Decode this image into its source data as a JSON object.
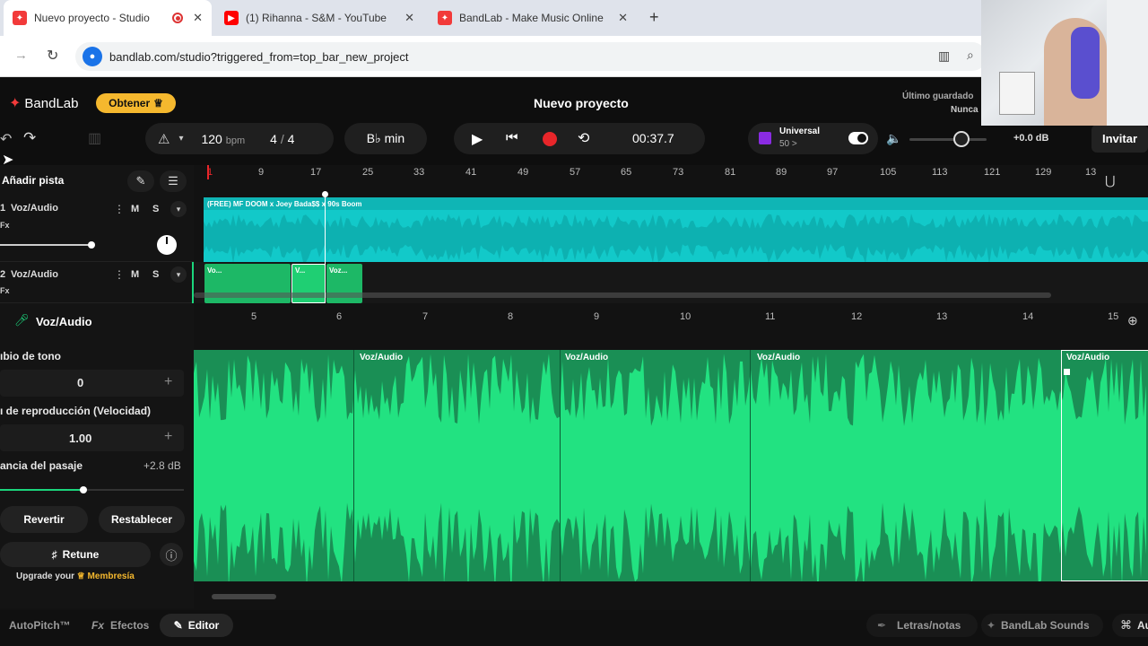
{
  "browser": {
    "tabs": [
      {
        "label": "Nuevo proyecto - Studio"
      },
      {
        "label": "(1) Rihanna - S&M - YouTube"
      },
      {
        "label": "BandLab - Make Music Online"
      }
    ],
    "url": "bandlab.com/studio?triggered_from=top_bar_new_project"
  },
  "app": {
    "brand": "BandLab",
    "get_label": "Obtener",
    "project_title": "Nuevo proyecto",
    "last_saved_label": "Último guardado",
    "last_saved_value": "Nunca",
    "invite_label": "Invitar"
  },
  "transport": {
    "bpm": "120",
    "bpm_unit": "bpm",
    "time_sig_num": "4",
    "time_sig_sep": "/",
    "time_sig_den": "4",
    "key": "B♭ min",
    "time": "00:37.7",
    "preset_name": "Universal",
    "preset_sub": "50 >",
    "volume_db": "+0.0 dB"
  },
  "tracks_header": {
    "add_track_label": "Añadir pista"
  },
  "ruler": [
    "1",
    "9",
    "17",
    "25",
    "33",
    "41",
    "49",
    "57",
    "65",
    "73",
    "81",
    "89",
    "97",
    "105",
    "113",
    "121",
    "129",
    "13"
  ],
  "tracks": [
    {
      "number": "1",
      "name": "Voz/Audio",
      "fx": "Fx",
      "mute": "M",
      "solo": "S",
      "region": "(FREE) MF DOOM x Joey Bada$$ x 90s Boom"
    },
    {
      "number": "2",
      "name": "Voz/Audio",
      "fx": "Fx",
      "mute": "M",
      "solo": "S",
      "regions": [
        "Vo...",
        "V...",
        "Voz..."
      ]
    }
  ],
  "editor": {
    "track_name": "Voz/Audio",
    "pitch_label": "ıbio de tono",
    "pitch_value": "0",
    "speed_label": "ı de reproducción (Velocidad)",
    "speed_value": "1.00",
    "gain_label": "ancia del pasaje",
    "gain_value": "+2.8 dB",
    "revert_label": "Revertir",
    "reset_label": "Restablecer",
    "retune_label": "Retune",
    "upgrade_prefix": "Upgrade your",
    "upgrade_link": "Membresía",
    "ruler": [
      "5",
      "6",
      "7",
      "8",
      "9",
      "10",
      "11",
      "12",
      "13",
      "14",
      "15"
    ],
    "regions": [
      "Voz/Audio",
      "Voz/Audio",
      "Voz/Audio",
      "Voz/Audio"
    ]
  },
  "bottom": {
    "autopitch": "AutoPitch™",
    "fx_prefix": "Fx",
    "effects": "Efectos",
    "editor": "Editor",
    "lyrics": "Letras/notas",
    "sounds": "BandLab Sounds",
    "cut": "Au"
  },
  "colors": {
    "accent_green": "#1bd67d",
    "track1_cyan": "#12c9c9",
    "record_red": "#e8262a",
    "brand_red": "#f23a3a",
    "get_button": "#f5b82e"
  }
}
